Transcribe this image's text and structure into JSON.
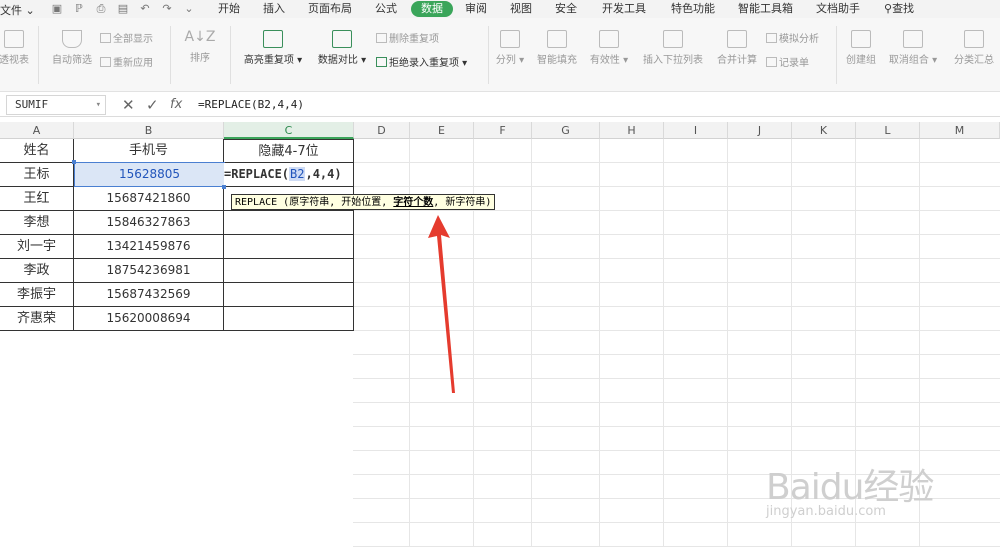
{
  "menubar": {
    "file_label": "文件",
    "tabs": [
      "开始",
      "插入",
      "页面布局",
      "公式",
      "数据",
      "审阅",
      "视图",
      "安全",
      "开发工具",
      "特色功能",
      "智能工具箱",
      "文档助手"
    ],
    "active_tab": "数据",
    "search_label": "查找"
  },
  "ribbon": {
    "pivot": "透视表",
    "auto_filter": "自动筛选",
    "show_all": "全部显示",
    "reapply": "重新应用",
    "sort": "排序",
    "highlight_dup": "高亮重复项",
    "data_compare": "数据对比",
    "remove_dup": "删除重复项",
    "reject_dup": "拒绝录入重复项",
    "split_col": "分列",
    "smart_fill": "智能填充",
    "validity": "有效性",
    "dropdown_list": "插入下拉列表",
    "consolidate": "合并计算",
    "simulate": "模拟分析",
    "record": "记录单",
    "create_group": "创建组",
    "ungroup": "取消组合",
    "subtotal": "分类汇总"
  },
  "formula_bar": {
    "name_box": "SUMIF",
    "formula": "=REPLACE(B2,4,4)",
    "fx": "fx"
  },
  "grid": {
    "columns": [
      "A",
      "B",
      "C",
      "D",
      "E",
      "F",
      "G",
      "H",
      "I",
      "J",
      "K",
      "L",
      "M"
    ],
    "headers": {
      "a": "姓名",
      "b": "手机号",
      "c": "隐藏4-7位"
    },
    "rows": [
      {
        "name": "王标",
        "phone": "15628805"
      },
      {
        "name": "王红",
        "phone": "15687421860"
      },
      {
        "name": "李想",
        "phone": "15846327863"
      },
      {
        "name": "刘一宇",
        "phone": "13421459876"
      },
      {
        "name": "李政",
        "phone": "18754236981"
      },
      {
        "name": "李振宇",
        "phone": "15687432569"
      },
      {
        "name": "齐惠荣",
        "phone": "15620008694"
      }
    ],
    "editing": {
      "prefix": "=REPLACE(",
      "ref": "B2",
      "suffix": ",4,4)"
    }
  },
  "tooltip": {
    "fn": "REPLACE",
    "open": " (",
    "arg1": "原字符串",
    "arg2": "开始位置",
    "arg3": "字符个数",
    "arg4": "新字符串",
    "close": ")"
  },
  "watermark": {
    "line1": "Baidu经验",
    "line2": "jingyan.baidu.com"
  },
  "colors": {
    "accent": "#3aa55a",
    "arrow": "#e53b2e",
    "selection": "#4a7fd1"
  }
}
